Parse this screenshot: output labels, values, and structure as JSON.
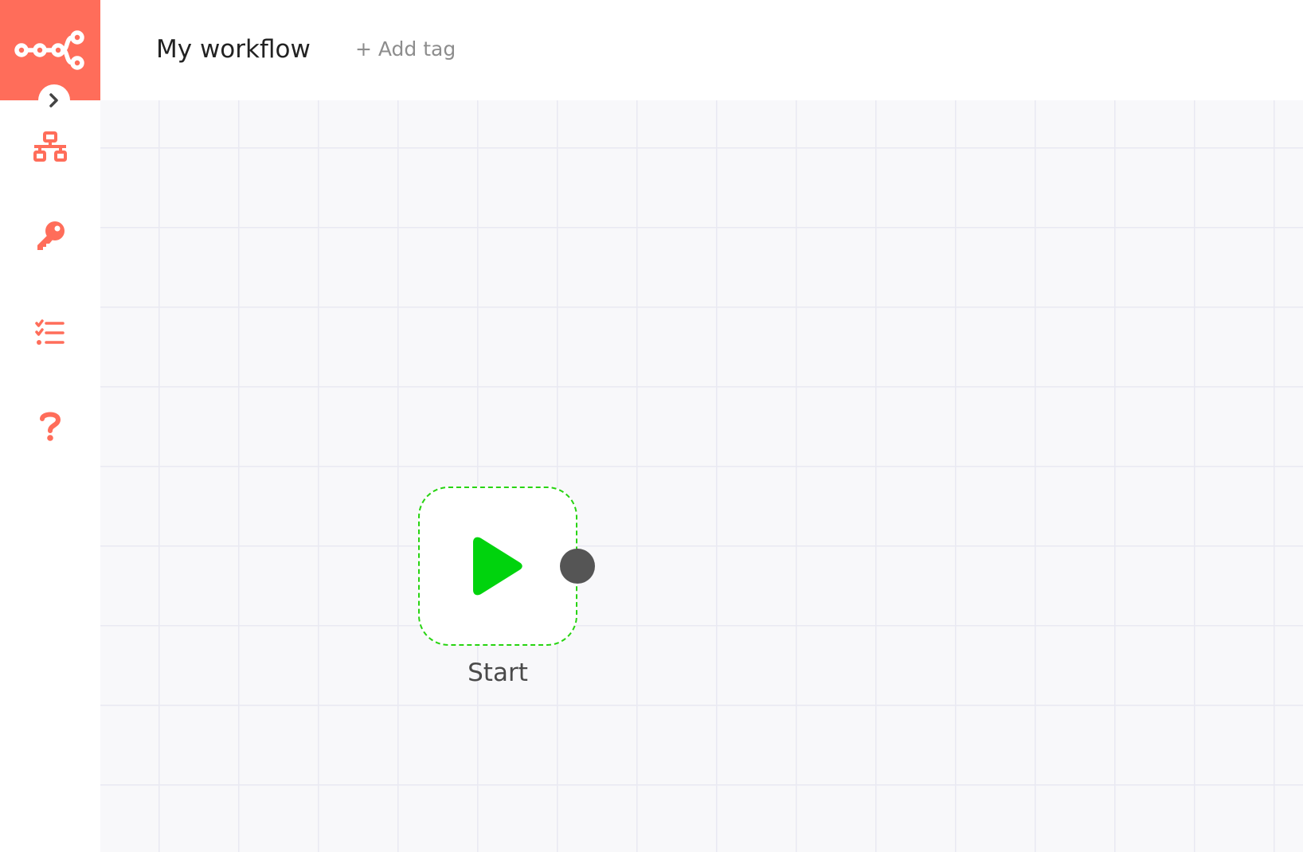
{
  "app": {
    "accent_color": "#ff6d5a",
    "logo_icon": "n8n-logo-icon"
  },
  "header": {
    "workflow_name": "My workflow",
    "add_tag_label": "+ Add tag"
  },
  "sidebar": {
    "expand_icon": "chevron-right-icon",
    "items": [
      {
        "name": "workflows",
        "icon": "sitemap-icon"
      },
      {
        "name": "credentials",
        "icon": "key-icon"
      },
      {
        "name": "executions",
        "icon": "tasks-icon"
      },
      {
        "name": "help",
        "icon": "question-icon"
      }
    ]
  },
  "canvas": {
    "background_color": "#f8f8fa",
    "grid_color": "#e9e9f2",
    "nodes": [
      {
        "label": "Start",
        "icon": "play-icon",
        "icon_color": "#00d30d",
        "border_color": "#27d411",
        "output_handle_color": "#555555"
      }
    ]
  }
}
